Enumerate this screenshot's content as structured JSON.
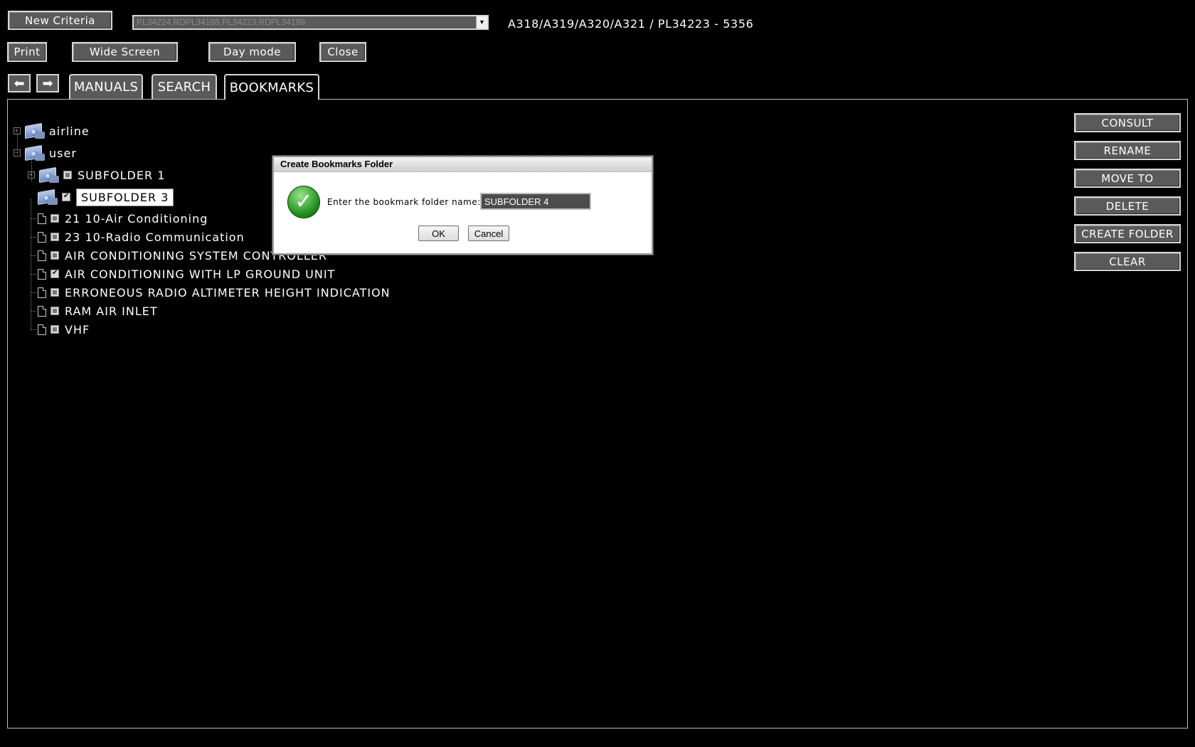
{
  "toolbar": {
    "new_criteria": "New Criteria",
    "criteria_value": "PL34224,RDPL34188,PL34223,RDPL34199",
    "print": "Print",
    "wide_screen": "Wide Screen",
    "day_mode": "Day mode",
    "close": "Close",
    "aircraft_info": "A318/A319/A320/A321 /  PL34223 - 5356"
  },
  "nav": {
    "back_icon": "left-arrow-icon",
    "forward_icon": "right-arrow-icon"
  },
  "tabs": [
    {
      "label": "MANUALS"
    },
    {
      "label": "SEARCH"
    },
    {
      "label": "BOOKMARKS"
    }
  ],
  "tree": {
    "airline": "airline",
    "user": "user",
    "subfolder1": "SUBFOLDER 1",
    "subfolder3": "SUBFOLDER 3",
    "docs": [
      {
        "label": "21 10-Air Conditioning",
        "checked": false
      },
      {
        "label": "23 10-Radio Communication",
        "checked": false
      },
      {
        "label": "AIR CONDITIONING SYSTEM CONTROLLER",
        "checked": false
      },
      {
        "label": "AIR CONDITIONING WITH LP GROUND UNIT",
        "checked": true
      },
      {
        "label": "ERRONEOUS RADIO ALTIMETER HEIGHT INDICATION",
        "checked": false
      },
      {
        "label": "RAM AIR INLET",
        "checked": false
      },
      {
        "label": "VHF",
        "checked": false
      }
    ]
  },
  "actions": {
    "consult": "CONSULT",
    "rename": "RENAME",
    "move_to": "MOVE TO",
    "delete": "DELETE",
    "create_folder": "CREATE FOLDER",
    "clear": "CLEAR"
  },
  "dialog": {
    "title": "Create Bookmarks Folder",
    "prompt": "Enter the bookmark folder name:",
    "input_value": "SUBFOLDER 4",
    "ok": "OK",
    "cancel": "Cancel"
  }
}
